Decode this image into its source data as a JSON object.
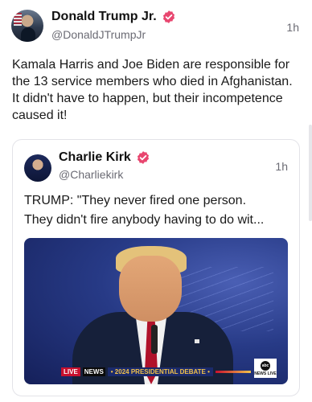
{
  "post": {
    "author_name": "Donald Trump Jr.",
    "author_handle": "@DonaldJTrumpJr",
    "time": "1h",
    "text": "Kamala Harris and Joe Biden are responsible for the 13 service members who died in Afghanistan. It didn't have to happen, but their incompetence caused it!",
    "verified_badge_color": "#e8466f"
  },
  "quote": {
    "author_name": "Charlie Kirk",
    "author_handle": "@Charliekirk",
    "time": "1h",
    "lines": [
      "TRUMP: \"They never fired one person.",
      "They didn't fire anybody having to do wit..."
    ],
    "verified_badge_color": "#e8466f"
  },
  "media": {
    "chyron_live": "LIVE",
    "chyron_network": "NEWS",
    "chyron_title": "• 2024 PRESIDENTIAL DEBATE •",
    "logo_text": "abc",
    "logo_sub": "NEWS LIVE"
  }
}
